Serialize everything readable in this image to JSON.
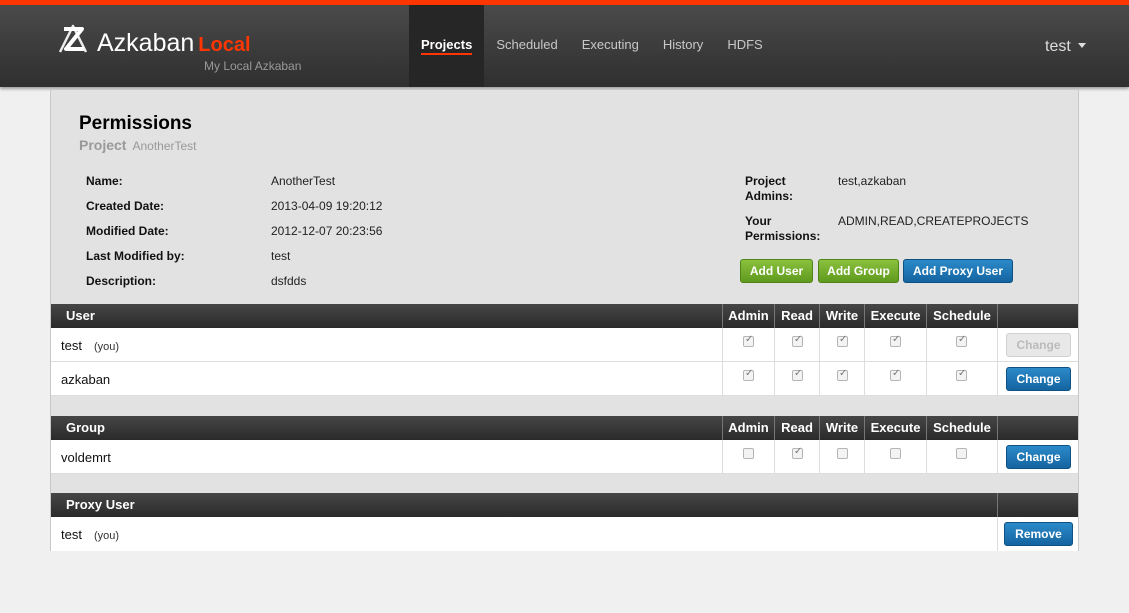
{
  "header": {
    "brand": "Azkaban",
    "env": "Local",
    "subtitle": "My Local Azkaban",
    "nav": [
      {
        "label": "Projects",
        "active": true
      },
      {
        "label": "Scheduled",
        "active": false
      },
      {
        "label": "Executing",
        "active": false
      },
      {
        "label": "History",
        "active": false
      },
      {
        "label": "HDFS",
        "active": false
      }
    ],
    "user": "test"
  },
  "page": {
    "title": "Permissions",
    "project_label": "Project",
    "project_name": "AnotherTest"
  },
  "info": [
    {
      "key": "Name:",
      "value": "AnotherTest"
    },
    {
      "key": "Created Date:",
      "value": "2013-04-09 19:20:12"
    },
    {
      "key": "Modified Date:",
      "value": "2012-12-07 20:23:56"
    },
    {
      "key": "Last Modified by:",
      "value": "test"
    },
    {
      "key": "Description:",
      "value": "dsfdds"
    }
  ],
  "admins": {
    "admins_key": "Project Admins:",
    "admins_value": "test,azkaban",
    "perms_key": "Your Permissions:",
    "perms_value": "ADMIN,READ,CREATEPROJECTS"
  },
  "actions": {
    "add_user": "Add User",
    "add_group": "Add Group",
    "add_proxy": "Add Proxy User"
  },
  "columns": [
    "Admin",
    "Read",
    "Write",
    "Execute",
    "Schedule"
  ],
  "user_table": {
    "header": "User",
    "rows": [
      {
        "name": "test",
        "tag": "(you)",
        "perms": [
          true,
          true,
          true,
          true,
          true
        ],
        "button": "Change",
        "button_disabled": true
      },
      {
        "name": "azkaban",
        "tag": "",
        "perms": [
          true,
          true,
          true,
          true,
          true
        ],
        "button": "Change",
        "button_disabled": false
      }
    ]
  },
  "group_table": {
    "header": "Group",
    "rows": [
      {
        "name": "voldemrt",
        "perms": [
          false,
          true,
          false,
          false,
          false
        ],
        "button": "Change"
      }
    ]
  },
  "proxy_table": {
    "header": "Proxy User",
    "rows": [
      {
        "name": "test",
        "tag": "(you)",
        "button": "Remove"
      }
    ]
  },
  "colors": {
    "accent": "#ff3601",
    "green": "#6aaa24",
    "blue": "#1a73b2"
  }
}
